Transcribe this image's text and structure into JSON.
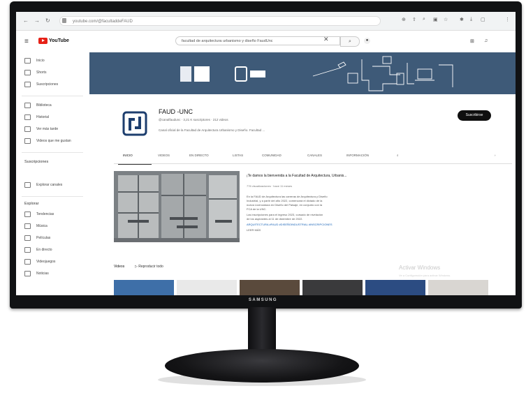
{
  "monitor": {
    "brand": "SAMSUNG"
  },
  "browser": {
    "url": "youtube.com/@facultaddeFAUD",
    "nav_icons": [
      "back-icon",
      "forward-icon",
      "reload-icon"
    ],
    "extension_icons": [
      "translate-icon",
      "share-icon",
      "zoom-icon",
      "screenshot-icon",
      "star-icon",
      "extensions-icon",
      "download-icon",
      "profile-icon",
      "more-icon"
    ]
  },
  "youtube": {
    "logo": "YouTube",
    "search_query": "facultad de arquitectura urbanismo y diseño FaudUnc",
    "header_icons": [
      "create-icon",
      "bell-icon"
    ]
  },
  "sidebar": {
    "main": [
      {
        "label": "Inicio",
        "icon": "home-icon"
      },
      {
        "label": "Shorts",
        "icon": "shorts-icon"
      },
      {
        "label": "Suscripciones",
        "icon": "subscriptions-icon"
      }
    ],
    "library": [
      {
        "label": "Biblioteca",
        "icon": "library-icon"
      },
      {
        "label": "Historial",
        "icon": "history-icon"
      },
      {
        "label": "Ver más tarde",
        "icon": "watch-later-icon"
      },
      {
        "label": "Videos que me gustan",
        "icon": "like-icon"
      }
    ],
    "subs_heading": "Suscripciones",
    "browse_channels": "Explorar canales",
    "explore_heading": "Explorar",
    "explore": [
      {
        "label": "Tendencias",
        "icon": "trending-icon"
      },
      {
        "label": "Música",
        "icon": "music-icon"
      },
      {
        "label": "Películas",
        "icon": "movies-icon"
      },
      {
        "label": "En directo",
        "icon": "live-icon"
      },
      {
        "label": "Videojuegos",
        "icon": "gaming-icon"
      },
      {
        "label": "Noticias",
        "icon": "news-icon"
      }
    ]
  },
  "channel": {
    "name": "FAUD -UNC",
    "meta": "@canalfaudunc · 3,21 K suscriptores · 212 videos",
    "description": "Canal oficial de la Facultad de Arquitectura Urbanismo y Diseño. Facultad ...",
    "subscribe": "Suscribirse",
    "tabs": [
      "INICIO",
      "VIDEOS",
      "EN DIRECTO",
      "LISTAS",
      "COMUNIDAD",
      "CANALES",
      "INFORMACIÓN"
    ]
  },
  "featured": {
    "title": "¡Te damos la bienvenida a la Facultad de Arquitectura, Urbanis...",
    "meta": "776 visualizaciones · hace 11 meses",
    "lines": [
      "En la FAUD de Arquitectura las carreras de Arquitectura y Diseño",
      "Industrial, y a partir del año 2022, comenzará el dictado de la",
      "nueva Licenciatura en Diseño del Paisaje, en conjunto con la",
      "FCA de la UNC.",
      "Las inscripciones para el ingreso 2023, cursado de nivelación",
      "de los aspirantes al 11 de diciembre de 2022."
    ],
    "link": "ARQUITECTURA  #FAUD  #DISEÑOINDUSTRIAL  #INSCRIPCIONES",
    "more": "LEER MÁS"
  },
  "videos_section": {
    "title": "Videos",
    "play_all": "Reproducir todo"
  },
  "watermark": {
    "title": "Activar Windows",
    "subtitle": "Ve a Configuración para activar Windows."
  },
  "colors": {
    "banner": "#3e5a78",
    "youtube_red": "#e62117",
    "brand_blue": "#1d3e6e"
  }
}
